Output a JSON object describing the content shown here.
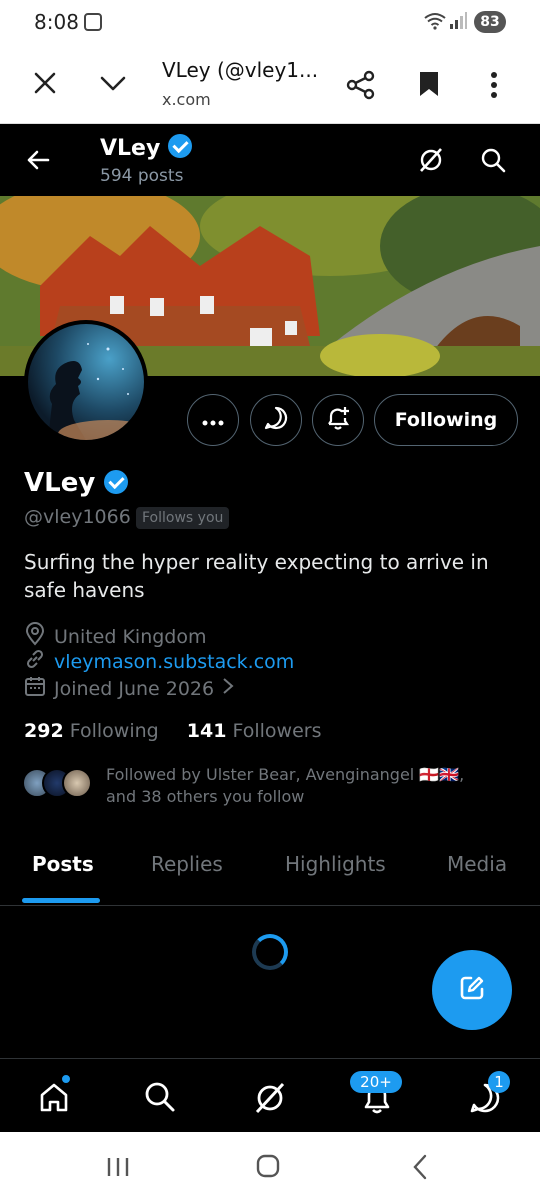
{
  "status_bar": {
    "time": "8:08",
    "battery": "83"
  },
  "browser": {
    "title": "VLey (@vley1...",
    "url": "x.com"
  },
  "header": {
    "name": "VLey",
    "posts": "594 posts"
  },
  "profile": {
    "name": "VLey",
    "handle": "@vley1066",
    "follows_you": "Follows you",
    "bio": "Surfing the hyper reality expecting to arrive in safe havens",
    "location": "United Kingdom",
    "website": "vleymason.substack.com",
    "joined": "Joined June 2026",
    "following_count": "292",
    "following_label": "Following",
    "followers_count": "141",
    "followers_label": "Followers",
    "followed_by_line1": "Followed by Ulster Bear, Avenginangel 🏴󠁧󠁢󠁥󠁮󠁧󠁿🇬🇧,",
    "followed_by_line2": "and 38 others you follow"
  },
  "actions": {
    "following_button": "Following"
  },
  "tabs": [
    "Posts",
    "Replies",
    "Highlights",
    "Media"
  ],
  "bottom_nav": {
    "notifications_badge": "20+",
    "messages_badge": "1"
  },
  "colors": {
    "accent": "#1d9bf0",
    "background": "#000000",
    "secondary_text": "#71767b"
  }
}
